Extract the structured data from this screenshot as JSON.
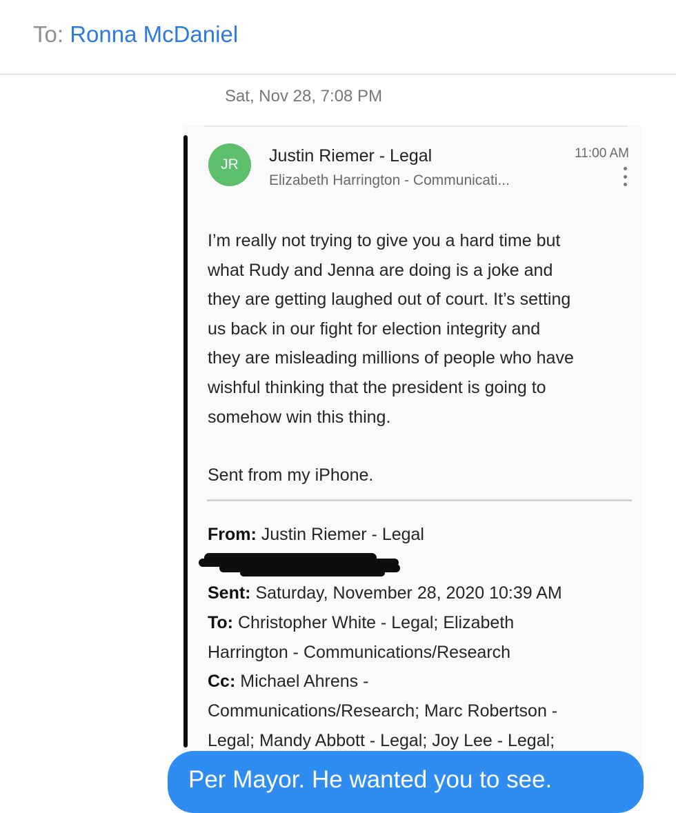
{
  "header": {
    "to_label": "To:",
    "recipient": "Ronna McDaniel"
  },
  "conversation": {
    "timestamp": "Sat, Nov 28, 7:08 PM"
  },
  "email": {
    "avatar_initials": "JR",
    "avatar_color": "#5cbf6b",
    "sender": "Justin Riemer - Legal",
    "recipient_line": "Elizabeth Harrington - Communicati...",
    "time": "11:00 AM",
    "body_lines": [
      "I’m really not trying to give you a hard time but",
      "what Rudy and Jenna are doing is a joke and",
      "they are getting laughed out of court. It’s setting",
      "us back in our fight for election integrity and",
      "they are misleading millions of people who have",
      "wishful thinking that the president is going to",
      "somehow win this thing."
    ],
    "signature": "Sent from my iPhone.",
    "forward": {
      "from_label": "From:",
      "from_value": "Justin Riemer - Legal",
      "sent_label": "Sent:",
      "sent_value": "Saturday, November 28, 2020 10:39 AM",
      "to_label": "To:",
      "to_value_line1": "Christopher White - Legal; Elizabeth",
      "to_value_line2": "Harrington - Communications/Research",
      "cc_label": "Cc:",
      "cc_value_line1": "Michael Ahrens -",
      "cc_value_line2": "Communications/Research; Marc Robertson -",
      "cc_value_line3": "Legal; Mandy Abbott - Legal; Joy Lee - Legal;"
    }
  },
  "message": {
    "text": "Per Mayor. He wanted you to see.",
    "bubble_color": "#2f8cf0"
  }
}
